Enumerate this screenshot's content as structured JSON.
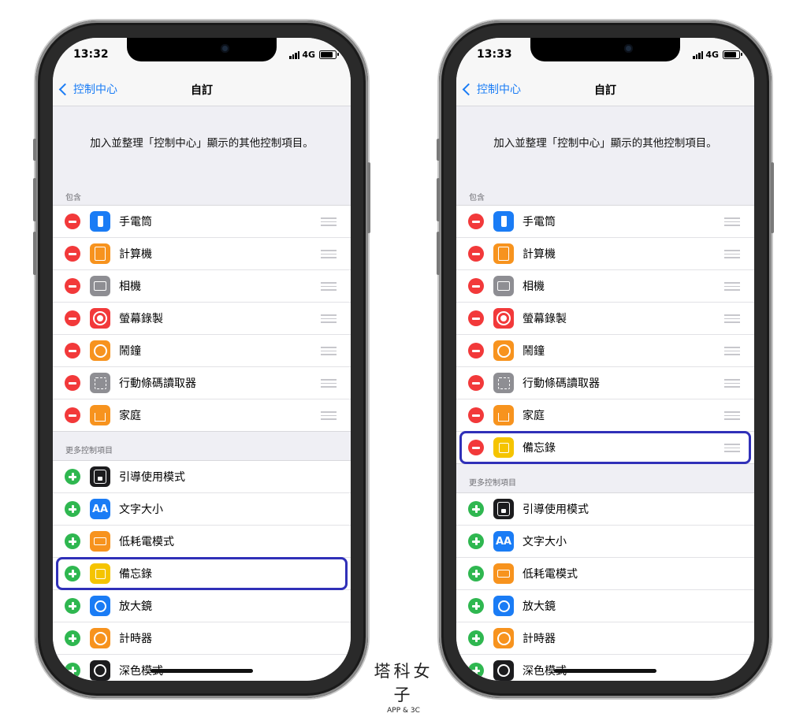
{
  "colors": {
    "ios_blue": "#1a7cf5",
    "remove_red": "#f2393a",
    "add_green": "#2fb750",
    "highlight_border": "#3030b8"
  },
  "phones": [
    {
      "status": {
        "time": "13:32",
        "network": "4G"
      },
      "nav": {
        "back_label": "控制中心",
        "title": "自訂"
      },
      "description": "加入並整理「控制中心」顯示的其他控制項目。",
      "included_header": "包含",
      "included": [
        {
          "label": "手電筒",
          "icon": "flashlight-icon",
          "color": "#1a7cf5"
        },
        {
          "label": "計算機",
          "icon": "calculator-icon",
          "color": "#f7931e"
        },
        {
          "label": "相機",
          "icon": "camera-icon",
          "color": "#8e8e93"
        },
        {
          "label": "螢幕錄製",
          "icon": "screen-record-icon",
          "color": "#f2393a"
        },
        {
          "label": "鬧鐘",
          "icon": "alarm-icon",
          "color": "#f7931e"
        },
        {
          "label": "行動條碼讀取器",
          "icon": "qr-code-icon",
          "color": "#8e8e93"
        },
        {
          "label": "家庭",
          "icon": "home-icon",
          "color": "#f7931e"
        }
      ],
      "more_header": "更多控制項目",
      "more": [
        {
          "label": "引導使用模式",
          "icon": "guided-access-icon",
          "color": "#1c1c1e"
        },
        {
          "label": "文字大小",
          "icon": "text-size-icon",
          "color": "#1a7cf5",
          "glyph": "AA"
        },
        {
          "label": "低耗電模式",
          "icon": "low-power-icon",
          "color": "#f7931e"
        },
        {
          "label": "備忘錄",
          "icon": "notes-icon",
          "color": "#f5c400",
          "highlighted": true
        },
        {
          "label": "放大鏡",
          "icon": "magnifier-icon",
          "color": "#1a7cf5"
        },
        {
          "label": "計時器",
          "icon": "timer-icon",
          "color": "#f7931e"
        },
        {
          "label": "深色模式",
          "icon": "dark-mode-icon",
          "color": "#1c1c1e"
        }
      ]
    },
    {
      "status": {
        "time": "13:33",
        "network": "4G"
      },
      "nav": {
        "back_label": "控制中心",
        "title": "自訂"
      },
      "description": "加入並整理「控制中心」顯示的其他控制項目。",
      "included_header": "包含",
      "included": [
        {
          "label": "手電筒",
          "icon": "flashlight-icon",
          "color": "#1a7cf5"
        },
        {
          "label": "計算機",
          "icon": "calculator-icon",
          "color": "#f7931e"
        },
        {
          "label": "相機",
          "icon": "camera-icon",
          "color": "#8e8e93"
        },
        {
          "label": "螢幕錄製",
          "icon": "screen-record-icon",
          "color": "#f2393a"
        },
        {
          "label": "鬧鐘",
          "icon": "alarm-icon",
          "color": "#f7931e"
        },
        {
          "label": "行動條碼讀取器",
          "icon": "qr-code-icon",
          "color": "#8e8e93"
        },
        {
          "label": "家庭",
          "icon": "home-icon",
          "color": "#f7931e"
        },
        {
          "label": "備忘錄",
          "icon": "notes-icon",
          "color": "#f5c400",
          "highlighted": true
        }
      ],
      "more_header": "更多控制項目",
      "more": [
        {
          "label": "引導使用模式",
          "icon": "guided-access-icon",
          "color": "#1c1c1e"
        },
        {
          "label": "文字大小",
          "icon": "text-size-icon",
          "color": "#1a7cf5",
          "glyph": "AA"
        },
        {
          "label": "低耗電模式",
          "icon": "low-power-icon",
          "color": "#f7931e"
        },
        {
          "label": "放大鏡",
          "icon": "magnifier-icon",
          "color": "#1a7cf5"
        },
        {
          "label": "計時器",
          "icon": "timer-icon",
          "color": "#f7931e"
        },
        {
          "label": "深色模式",
          "icon": "dark-mode-icon",
          "color": "#1c1c1e"
        }
      ]
    }
  ],
  "watermark": {
    "title": "塔科女子",
    "subtitle": "APP & 3C"
  }
}
